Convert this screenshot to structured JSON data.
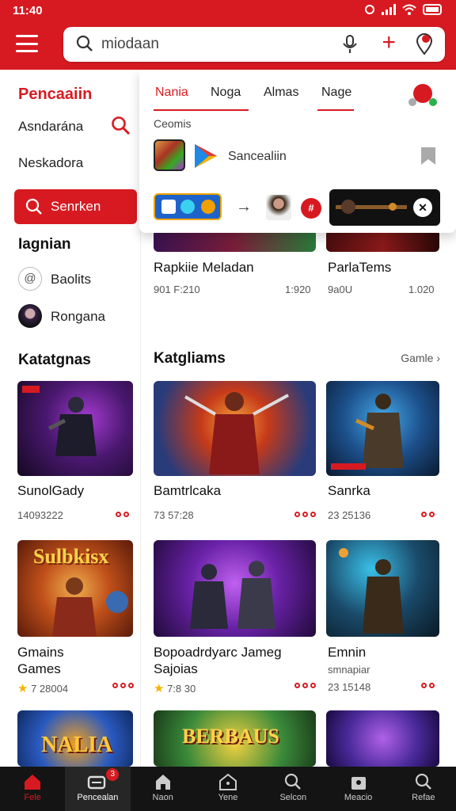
{
  "status": {
    "time": "11:40"
  },
  "search": {
    "query": "miodaan"
  },
  "sidebar": {
    "title": "Pencaaiin",
    "items": [
      {
        "label": "Asndarána"
      },
      {
        "label": "Neskadora"
      }
    ],
    "button_label": "Senrken",
    "section1": "Iagnian",
    "links": [
      {
        "label": "Baolits",
        "glyph": "@"
      },
      {
        "label": "Rongana"
      }
    ],
    "section2": "Katatgnas"
  },
  "dropdown": {
    "tabs": [
      {
        "label": "Nania",
        "active": true
      },
      {
        "label": "Noga",
        "active": false
      },
      {
        "label": "Almas",
        "active": false
      },
      {
        "label": "Nage",
        "active": false
      }
    ],
    "section_label": "Ceomis",
    "app_name": "Sancealiin",
    "badge_text": "#"
  },
  "top_cards": [
    {
      "title": "Rapkiie Meladan",
      "meta_left": "901 F:210",
      "meta_right": "1:920"
    },
    {
      "title": "ParlaTems",
      "meta_left": "9a0U",
      "meta_right": "1.020"
    }
  ],
  "main": {
    "section_title": "Katgliams",
    "see_more": "Gamle"
  },
  "grid": [
    {
      "title": "SunolGady",
      "meta": "14093222",
      "thumb": "sidebar"
    },
    {
      "title": "Bamtrlcaka",
      "meta": "73 57:28",
      "thumb": "hero-red"
    },
    {
      "title": "Sanrka",
      "meta": "23 25136",
      "thumb": "hero-blue"
    },
    {
      "title": "Gmains",
      "title2": "Games",
      "meta": "7 28004",
      "star": true,
      "banner": "Sulbkisx"
    },
    {
      "title": "Bopoadrdyarc Jameg",
      "title2": "Sajoias",
      "meta": "7:8 30",
      "star": true
    },
    {
      "title": "Emnin",
      "title2": "smnapiar",
      "meta": "23 15148"
    },
    {
      "title": "",
      "meta": "",
      "banner": "NALIA"
    },
    {
      "title": "",
      "meta": "",
      "banner": "BERBAUS"
    },
    {
      "title": "",
      "meta": ""
    }
  ],
  "bottom_nav": [
    {
      "label": "Fele",
      "icon": "home-icon",
      "active": true
    },
    {
      "label": "Pencealan",
      "icon": "library-icon",
      "selected": true,
      "badge": "3"
    },
    {
      "label": "Naon",
      "icon": "store-icon"
    },
    {
      "label": "Yene",
      "icon": "house-icon"
    },
    {
      "label": "Selcon",
      "icon": "search-icon"
    },
    {
      "label": "Meacio",
      "icon": "bag-icon"
    },
    {
      "label": "Refae",
      "icon": "search-alt-icon"
    }
  ],
  "colors": {
    "accent": "#d71a21",
    "nav_bg": "#141414"
  }
}
